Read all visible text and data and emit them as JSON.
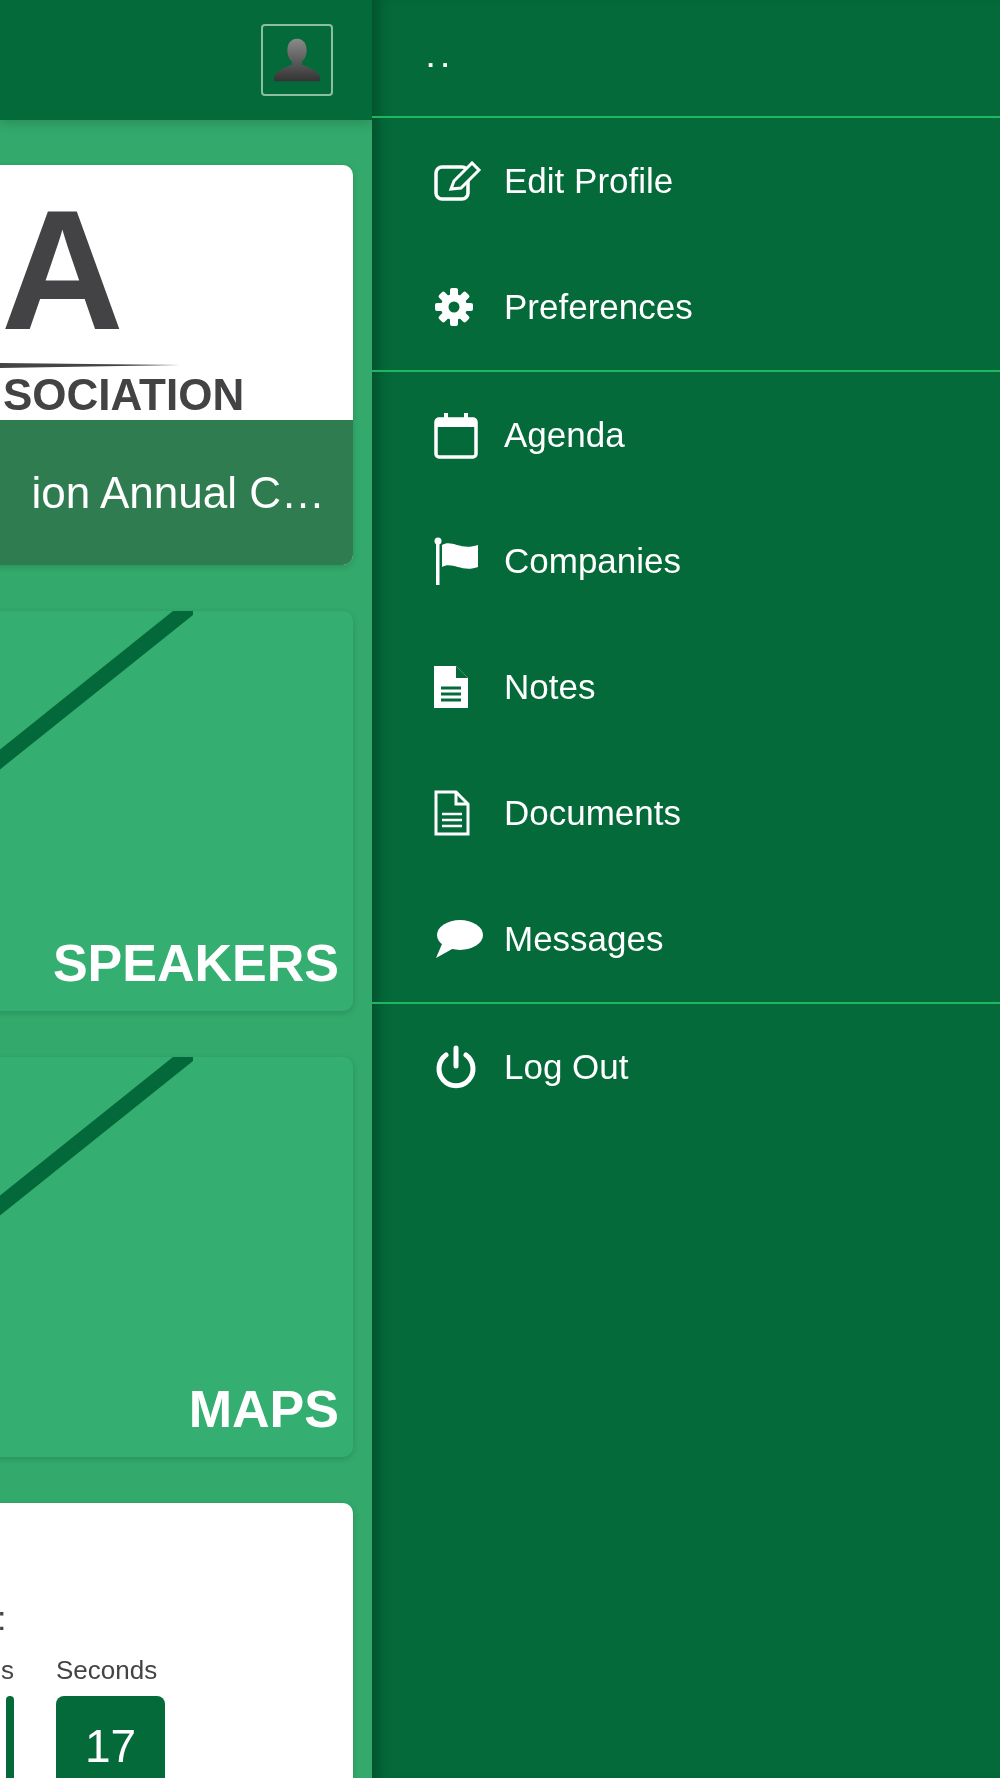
{
  "cards": [
    {
      "kind": "logo",
      "logo_letter": "A",
      "logo_text": "SOCIATION",
      "title": "ion Annual C…"
    },
    {
      "kind": "banner",
      "label": "SPEAKERS"
    },
    {
      "kind": "banner",
      "label": "MAPS"
    },
    {
      "kind": "countdown",
      "separator": ":",
      "units": [
        {
          "label": "s"
        },
        {
          "label": "Seconds",
          "value": "17"
        }
      ]
    }
  ],
  "menu": {
    "title": ". .",
    "groups": [
      [
        {
          "label": "Edit Profile"
        },
        {
          "label": "Preferences"
        }
      ],
      [
        {
          "label": "Agenda"
        },
        {
          "label": "Companies"
        },
        {
          "label": "Notes"
        },
        {
          "label": "Documents"
        },
        {
          "label": "Messages"
        }
      ],
      [
        {
          "label": "Log Out"
        }
      ]
    ]
  }
}
